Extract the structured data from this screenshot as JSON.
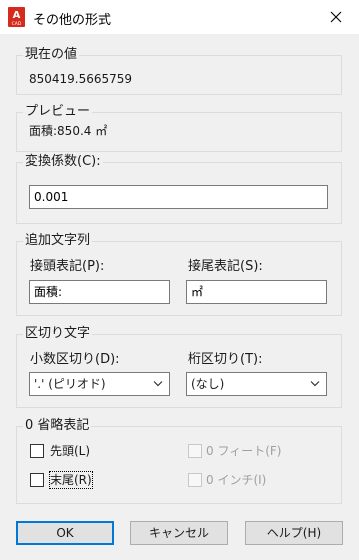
{
  "window": {
    "title": "その他の形式",
    "app_icon_label": "CAD",
    "app_icon_letter": "A"
  },
  "current_value": {
    "label": "現在の値",
    "value": "850419.5665759"
  },
  "preview": {
    "label": "プレビュー",
    "value": "面積:850.4 ㎡"
  },
  "conversion": {
    "label": "変換係数(C):",
    "value": "0.001"
  },
  "additional_text": {
    "label": "追加文字列",
    "prefix_label": "接頭表記(P):",
    "prefix_value": "面積:",
    "suffix_label": "接尾表記(S):",
    "suffix_value": "㎡"
  },
  "separator": {
    "label": "区切り文字",
    "decimal_label": "小数区切り(D):",
    "decimal_value": "'.' (ピリオド)",
    "thousands_label": "桁区切り(T):",
    "thousands_value": "(なし)"
  },
  "zero_suppression": {
    "label": "0 省略表記",
    "leading": "先頭(L)",
    "trailing": "末尾(R)",
    "feet": "0 フィート(F)",
    "inches": "0 インチ(I)",
    "leading_checked": false,
    "trailing_checked": false,
    "feet_enabled": false,
    "inches_enabled": false
  },
  "buttons": {
    "ok": "OK",
    "cancel": "キャンセル",
    "help": "ヘルプ(H)"
  },
  "colors": {
    "accent": "#0078d7",
    "app_icon_red": "#d52b1e"
  }
}
